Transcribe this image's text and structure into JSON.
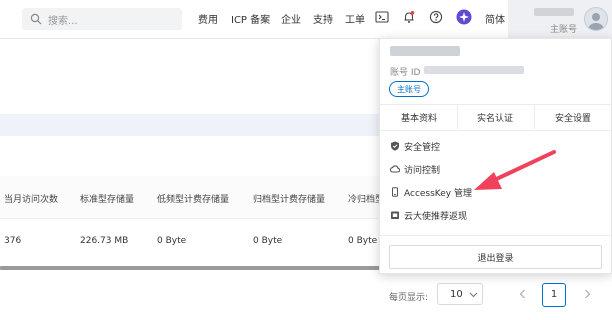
{
  "header": {
    "search_placeholder": "搜索...",
    "nav": [
      "费用",
      "ICP 备案",
      "企业",
      "支持",
      "工单"
    ],
    "language": "简体",
    "account_role": "主账号"
  },
  "table": {
    "headers": [
      "当月访问次数",
      "标准型存储量",
      "低频型计费存储量",
      "归档型计费存储量",
      "冷归档型"
    ],
    "row": [
      "376",
      "226.73 MB",
      "0 Byte",
      "0 Byte",
      "0 Byte"
    ]
  },
  "pagination": {
    "per_page_label": "每页显示:",
    "page_size": "10",
    "current_page": "1"
  },
  "account_menu": {
    "id_label": "账号 ID",
    "badge": "主账号",
    "tabs": [
      "基本资料",
      "实名认证",
      "安全设置"
    ],
    "items": [
      "安全管控",
      "访问控制",
      "AccessKey 管理",
      "云大使推荐返现"
    ],
    "logout": "退出登录"
  },
  "colors": {
    "accent": "#0070cc",
    "annotation_arrow": "#f0415d"
  },
  "icons": [
    "search-icon",
    "terminal-icon",
    "bell-icon",
    "help-icon",
    "app-logo-icon",
    "chevron-down-icon",
    "chevron-left-icon",
    "chevron-right-icon",
    "shield-icon",
    "cloud-icon",
    "key-icon",
    "gift-icon"
  ]
}
